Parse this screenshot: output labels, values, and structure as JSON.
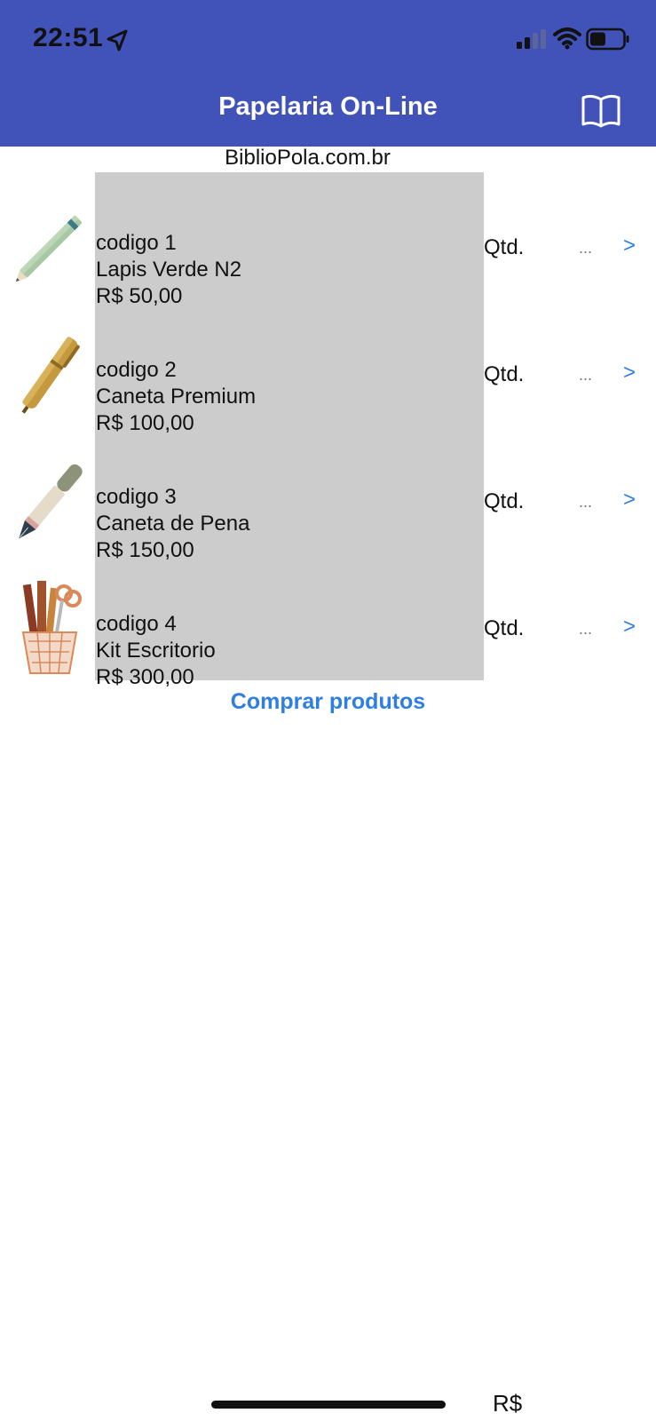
{
  "status_bar": {
    "time": "22:51"
  },
  "nav": {
    "title": "Papelaria On-Line"
  },
  "subtitle": "BiblioPola.com.br",
  "products": [
    {
      "code": "codigo 1",
      "name": "Lapis Verde N2",
      "price": "R$ 50,00",
      "qty_label": "Qtd.",
      "qty_placeholder": "...",
      "next_label": ">",
      "icon": "green-pencil-icon"
    },
    {
      "code": "codigo 2",
      "name": "Caneta Premium",
      "price": "R$ 100,00",
      "qty_label": "Qtd.",
      "qty_placeholder": "...",
      "next_label": ">",
      "icon": "gold-pen-icon"
    },
    {
      "code": "codigo 3",
      "name": "Caneta de Pena",
      "price": "R$ 150,00",
      "qty_label": "Qtd.",
      "qty_placeholder": "...",
      "next_label": ">",
      "icon": "fountain-pen-icon"
    },
    {
      "code": "codigo 4",
      "name": "Kit Escritorio",
      "price": "R$ 300,00",
      "qty_label": "Qtd.",
      "qty_placeholder": "...",
      "next_label": ">",
      "icon": "office-kit-icon"
    }
  ],
  "buy_button": "Comprar produtos",
  "total_label": "R$",
  "colors": {
    "nav_background": "#4152b8",
    "panel_gray": "#cccccc",
    "accent_blue": "#2e7ee3"
  }
}
